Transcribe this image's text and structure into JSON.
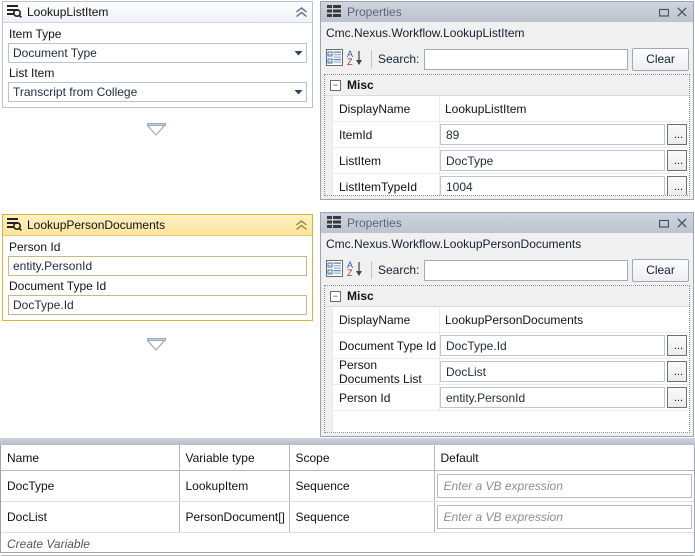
{
  "designer": {
    "activities": [
      {
        "icon": "lookup-list-icon",
        "title": "LookupListItem",
        "collapse_icon": "chevron-double-up-icon",
        "selected": false,
        "fields": [
          {
            "label": "Item Type",
            "value": "Document Type",
            "dropdown_icon": "chevron-down-icon"
          },
          {
            "label": "List Item",
            "value": "Transcript from College",
            "dropdown_icon": "chevron-down-icon"
          }
        ]
      },
      {
        "icon": "lookup-list-icon",
        "title": "LookupPersonDocuments",
        "collapse_icon": "chevron-double-up-icon",
        "selected": true,
        "fields": [
          {
            "label": "Person Id",
            "value": "entity.PersonId"
          },
          {
            "label": "Document Type Id",
            "value": "DocType.Id"
          }
        ]
      }
    ],
    "connector_icon": "drop-target-triangle-icon"
  },
  "properties_windows": [
    {
      "icon": "properties-grid-icon",
      "title": "Properties",
      "restore_icon": "restore-window-icon",
      "close_icon": "close-icon",
      "subtitle": "Cmc.Nexus.Workflow.LookupListItem",
      "toolbar": {
        "categorized_icon": "categorized-view-icon",
        "alphabetical_icon": "sort-alphabetical-icon",
        "search_label": "Search:",
        "search_value": "",
        "search_placeholder": "",
        "clear_label": "Clear"
      },
      "category": {
        "name": "Misc",
        "expander": "−"
      },
      "rows": [
        {
          "name": "DisplayName",
          "value": "LookupListItem",
          "editable": false
        },
        {
          "name": "ItemId",
          "value": "89",
          "editable": true,
          "ellipsis_label": "..."
        },
        {
          "name": "ListItem",
          "value": "DocType",
          "editable": true,
          "ellipsis_label": "..."
        },
        {
          "name": "ListItemTypeId",
          "value": "1004",
          "editable": true,
          "ellipsis_label": "..."
        }
      ]
    },
    {
      "icon": "properties-grid-icon",
      "title": "Properties",
      "restore_icon": "restore-window-icon",
      "close_icon": "close-icon",
      "subtitle": "Cmc.Nexus.Workflow.LookupPersonDocuments",
      "toolbar": {
        "categorized_icon": "categorized-view-icon",
        "alphabetical_icon": "sort-alphabetical-icon",
        "search_label": "Search:",
        "search_value": "",
        "search_placeholder": "",
        "clear_label": "Clear"
      },
      "category": {
        "name": "Misc",
        "expander": "−"
      },
      "rows": [
        {
          "name": "DisplayName",
          "value": "LookupPersonDocuments",
          "editable": false
        },
        {
          "name": "Document Type Id",
          "value": "DocType.Id",
          "editable": true,
          "ellipsis_label": "..."
        },
        {
          "name": "Person Documents List",
          "value": "DocList",
          "editable": true,
          "ellipsis_label": "..."
        },
        {
          "name": "Person Id",
          "value": "entity.PersonId",
          "editable": true,
          "ellipsis_label": "..."
        }
      ]
    }
  ],
  "variables": {
    "headers": [
      "Name",
      "Variable type",
      "Scope",
      "Default"
    ],
    "rows": [
      {
        "name": "DocType",
        "type": "LookupItem",
        "scope": "Sequence",
        "default": "Enter a VB expression"
      },
      {
        "name": "DocList",
        "type": "PersonDocument[]",
        "scope": "Sequence",
        "default": "Enter a VB expression"
      }
    ],
    "create_label": "Create Variable"
  },
  "colors": {
    "selection_header": "#fbe49c",
    "selection_border": "#d8b33a",
    "panel_border": "#b9c3d1",
    "titlebar": "#c3c9d4"
  }
}
